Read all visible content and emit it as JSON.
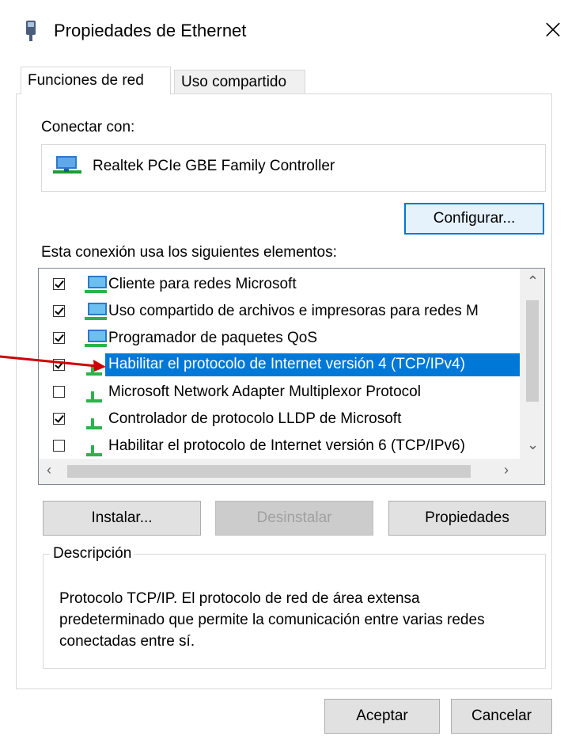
{
  "window": {
    "title": "Propiedades de Ethernet",
    "close_glyph": "×"
  },
  "tabs": [
    {
      "label": "Funciones de red",
      "active": true
    },
    {
      "label": "Uso compartido",
      "active": false
    }
  ],
  "connect": {
    "label": "Conectar con:",
    "adapter_name": "Realtek PCIe GBE Family Controller",
    "configure_button": "Configurar..."
  },
  "items_section": {
    "label": "Esta conexión usa los siguientes elementos:",
    "items": [
      {
        "label": "Cliente para redes Microsoft",
        "checked": true,
        "icon": "network-client-icon"
      },
      {
        "label": "Uso compartido de archivos e impresoras para redes M",
        "checked": true,
        "icon": "network-service-icon"
      },
      {
        "label": "Programador de paquetes QoS",
        "checked": true,
        "icon": "network-service-icon"
      },
      {
        "label": "Habilitar el protocolo de Internet versión 4 (TCP/IPv4)",
        "checked": true,
        "selected": true,
        "icon": "protocol-icon"
      },
      {
        "label": "Microsoft Network Adapter Multiplexor Protocol",
        "checked": false,
        "icon": "protocol-icon"
      },
      {
        "label": "Controlador de protocolo LLDP de Microsoft",
        "checked": true,
        "icon": "protocol-icon"
      },
      {
        "label": "Habilitar el protocolo de Internet versión 6 (TCP/IPv6)",
        "checked": false,
        "icon": "protocol-icon"
      }
    ]
  },
  "buttons": {
    "install": "Instalar...",
    "uninstall": "Desinstalar",
    "properties": "Propiedades",
    "ok": "Aceptar",
    "cancel": "Cancelar"
  },
  "description": {
    "legend": "Descripción",
    "text": "Protocolo TCP/IP. El protocolo de red de área extensa predeterminado que permite la comunicación entre varias redes conectadas entre sí."
  },
  "colors": {
    "selection": "#0078d7",
    "annotation_arrow": "#cc0000"
  }
}
